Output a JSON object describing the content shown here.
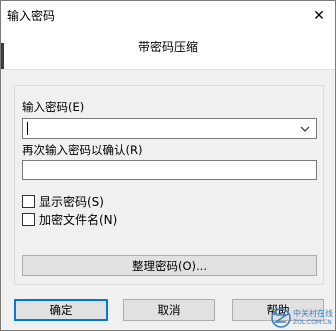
{
  "window": {
    "title": "输入密码",
    "close_glyph": "✕"
  },
  "header": {
    "text": "带密码压缩"
  },
  "password": {
    "label": "输入密码(E)",
    "value": "",
    "dropdown_icon": "chevron-down-icon"
  },
  "confirm": {
    "label": "再次输入密码以确认(R)",
    "value": ""
  },
  "options": {
    "show_password": {
      "label": "显示密码(S)",
      "checked": false
    },
    "encrypt_filenames": {
      "label": "加密文件名(N)",
      "checked": false
    }
  },
  "organize_button": {
    "label": "整理密码(O)..."
  },
  "buttons": {
    "ok": "确定",
    "cancel": "取消",
    "help": "帮助"
  },
  "watermark": {
    "cn": "中关村在线",
    "en": "ZOL.COM.CN"
  },
  "colors": {
    "accent": "#0078d7",
    "dialog_bg": "#f0f0f0",
    "watermark": "#3c7fc7"
  }
}
